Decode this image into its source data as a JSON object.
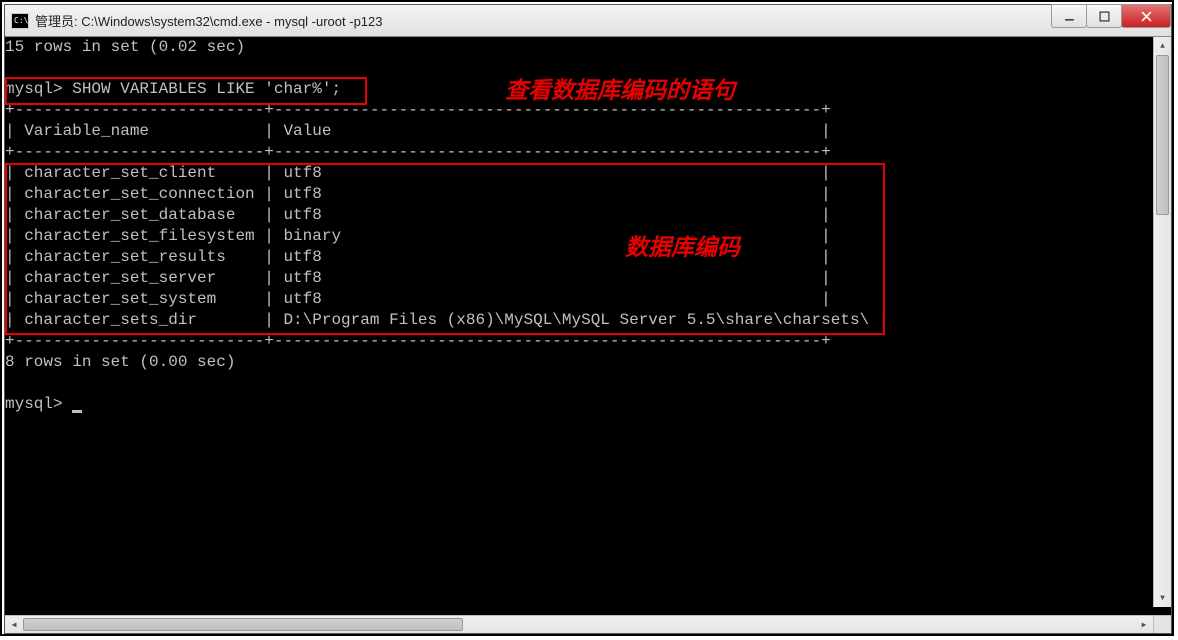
{
  "window": {
    "title": "管理员: C:\\Windows\\system32\\cmd.exe - mysql  -uroot -p123",
    "icon_text": "C:\\"
  },
  "terminal": {
    "line1": "15 rows in set (0.02 sec)",
    "blank": "",
    "prompt_line": "mysql> SHOW VARIABLES LIKE 'char%';",
    "divider_top": "+--------------------------+---------------------------------------------------------+",
    "header_row": "| Variable_name            | Value                                                   |",
    "divider_mid": "+--------------------------+---------------------------------------------------------+",
    "rows": [
      "| character_set_client     | utf8                                                    |",
      "| character_set_connection | utf8                                                    |",
      "| character_set_database   | utf8                                                    |",
      "| character_set_filesystem | binary                                                  |",
      "| character_set_results    | utf8                                                    |",
      "| character_set_server     | utf8                                                    |",
      "| character_set_system     | utf8                                                    |",
      "| character_sets_dir       | D:\\Program Files (x86)\\MySQL\\MySQL Server 5.5\\share\\charsets\\ |"
    ],
    "divider_bot": "+--------------------------+---------------------------------------------------------+",
    "summary": "8 rows in set (0.00 sec)",
    "prompt2": "mysql> "
  },
  "annotations": {
    "anno1": "查看数据库编码的语句",
    "anno2": "数据库编码"
  }
}
